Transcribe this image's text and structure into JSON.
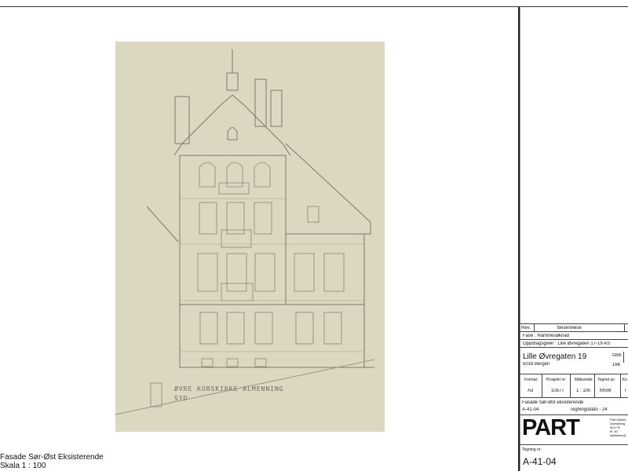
{
  "drawing": {
    "caption_line1": "Fasade Sør-Øst Eksisterende",
    "caption_line2": "Skala  1 : 100",
    "handwritten_1": "ØVRE KORSKIRKE ALMENNING",
    "handwritten_2": "SYD"
  },
  "title_block": {
    "rev_label": "Rev.",
    "description_label": "Beskrivelse",
    "phase": "Fase :  Rammesøknad",
    "client": "Oppdragsgiver :  Lille Øvregaten 17-19 AS",
    "project_name": "Lille Øvregaten 19",
    "address": "5018 Bergen",
    "gnr_label": "GNR:",
    "gnr_value": "166",
    "headers": [
      "Format:",
      "Prosjekt nr:",
      "Målestokk:",
      "Tegnet av:",
      "Ko"
    ],
    "values": [
      "A3",
      "10577",
      "1 : 100",
      "MSW",
      "I"
    ],
    "sheet_title": "Fasade Sør-Øst eksisterende",
    "sheet_number": "A-41-04",
    "drawing_date_label": "Tegningsdato - 24",
    "logo_text": "PART",
    "company_lines": [
      "Part Arkitek",
      "Domkirkeg",
      "5017 B",
      "tlf. 40",
      "arkitektur@"
    ],
    "drawing_no_label": "Tegning nr:",
    "drawing_no": "A-41-04"
  }
}
